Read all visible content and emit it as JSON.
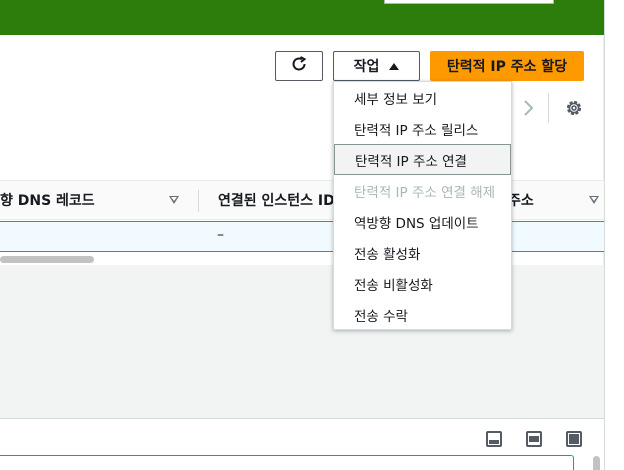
{
  "toolbar": {
    "actions_label": "작업",
    "allocate_label": "탄력적 IP 주소 할당"
  },
  "icons": {
    "refresh": "refresh-icon",
    "actions_caret": "caret-up-icon",
    "pager_next": "chevron-right-icon",
    "settings": "gear-icon"
  },
  "actions_menu": {
    "items": [
      {
        "label": "세부 정보 보기",
        "state": "enabled"
      },
      {
        "label": "탄력적 IP 주소 릴리스",
        "state": "enabled"
      },
      {
        "label": "탄력적 IP 주소 연결",
        "state": "highlighted"
      },
      {
        "label": "탄력적 IP 주소 연결 해제",
        "state": "disabled"
      },
      {
        "label": "역방향 DNS 업데이트",
        "state": "enabled"
      },
      {
        "label": "전송 활성화",
        "state": "enabled"
      },
      {
        "label": "전송 비활성화",
        "state": "enabled"
      },
      {
        "label": "전송 수락",
        "state": "enabled"
      }
    ]
  },
  "table": {
    "columns": [
      "향 DNS 레코드",
      "연결된 인스턴스 ID",
      "주소"
    ],
    "rows": [
      {
        "instance_id": "–"
      }
    ]
  },
  "colors": {
    "header_bar": "#2c7d0b",
    "primary_button": "#ff9900",
    "selected_row": "#f1faff",
    "selection_border": "#00a1c9"
  }
}
